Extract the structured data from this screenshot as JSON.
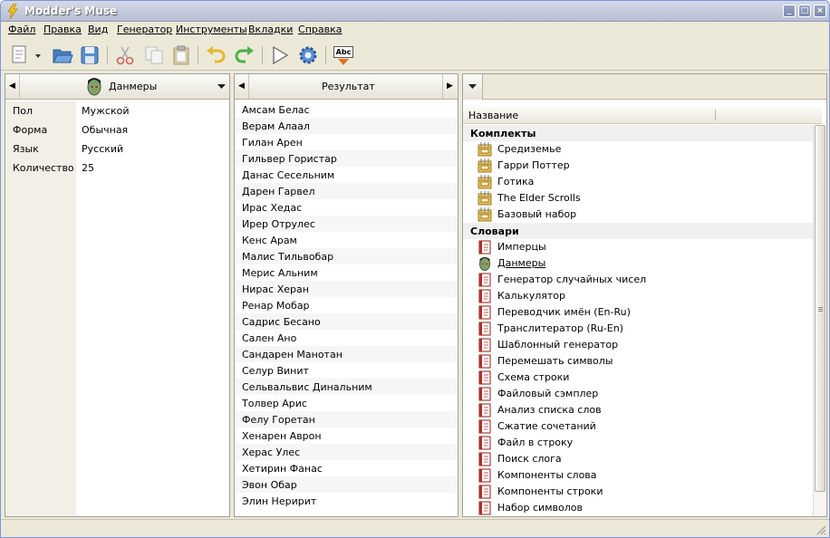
{
  "window": {
    "title": "Modder's Muse"
  },
  "menu": [
    "Файл",
    "Правка",
    "Вид",
    "Генератор",
    "Инструменты",
    "Вкладки",
    "Справка"
  ],
  "toolbar": {
    "icons": [
      "new-doc-icon",
      "dropdown-arrow-icon",
      "open-folder-icon",
      "save-icon",
      "cut-icon",
      "copy-icon",
      "paste-icon",
      "undo-icon",
      "redo-icon",
      "run-icon",
      "settings-gear-icon",
      "spellcheck-icon"
    ],
    "spell_label": "Abc"
  },
  "left_panel": {
    "selector_label": "Данмеры",
    "properties": [
      {
        "key": "Пол",
        "value": "Мужской"
      },
      {
        "key": "Форма",
        "value": "Обычная"
      },
      {
        "key": "Язык",
        "value": "Русский"
      },
      {
        "key": "Количество",
        "value": "25"
      }
    ]
  },
  "result_panel": {
    "header": "Результат",
    "items": [
      "Амсам Белас",
      "Верам Алаал",
      "Гилан Арен",
      "Гильвер Гористар",
      "Данас Сесельним",
      "Дарен Гарвел",
      "Ирас Хедас",
      "Ирер Отрулес",
      "Кенс Арам",
      "Малис Тильвобар",
      "Мерис Альним",
      "Нирас Херан",
      "Ренар Мобар",
      "Садрис Бесано",
      "Сален Ано",
      "Сандарен Манотан",
      "Селур Винит",
      "Сельвальвис Динальним",
      "Толвер Арис",
      "Фелу Горетан",
      "Хенарен Аврон",
      "Херас Улес",
      "Хетирин Фанас",
      "Эвон Обар",
      "Элин Неририт"
    ]
  },
  "right_panel": {
    "column_header": "Название",
    "groups": [
      {
        "title": "Комплекты",
        "items": [
          "Средиземье",
          "Гарри Поттер",
          "Готика",
          "The Elder Scrolls",
          "Базовый набор"
        ]
      },
      {
        "title": "Словари",
        "items": [
          "Имперцы",
          "Данмеры",
          "Генератор случайных чисел",
          "Калькулятор",
          "Переводчик имён (En-Ru)",
          "Транслитератор (Ru-En)",
          "Шаблонный генератор",
          "Перемешать символы",
          "Схема строки",
          "Файловый сэмплер",
          "Анализ списка слов",
          "Сжатие сочетаний",
          "Файл в строку",
          "Поиск слога",
          "Компоненты слова",
          "Компоненты строки",
          "Набор символов"
        ]
      }
    ]
  },
  "colors": {
    "accent": "#7a96df",
    "titlebar": "#c5cbdc",
    "book": "#b0302a"
  }
}
